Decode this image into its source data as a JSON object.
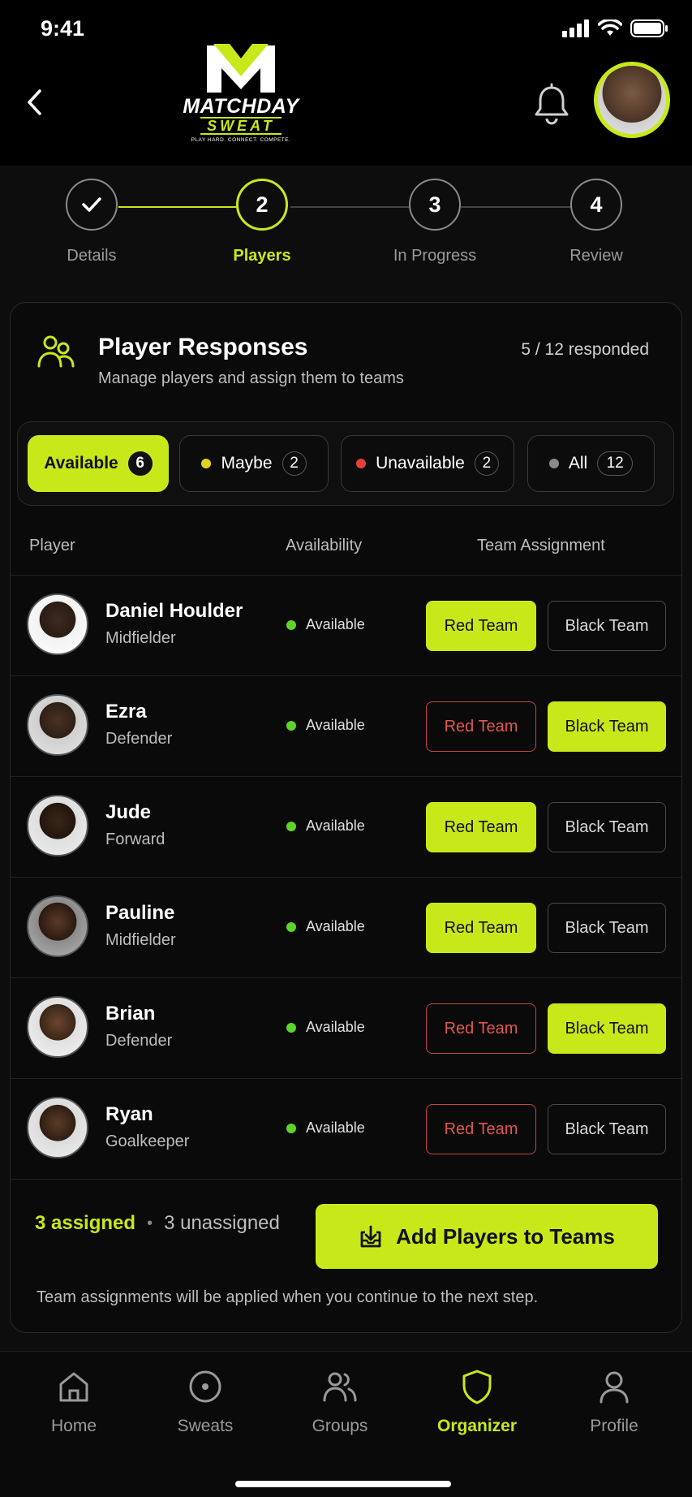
{
  "status_bar": {
    "time": "9:41"
  },
  "header": {
    "logo_line1": "MATCHDAY",
    "logo_line2": "SWEAT",
    "logo_tagline": "PLAY HARD. CONNECT. COMPETE."
  },
  "stepper": {
    "steps": [
      {
        "label": "Details",
        "number": "",
        "state": "done"
      },
      {
        "label": "Players",
        "number": "2",
        "state": "active"
      },
      {
        "label": "In Progress",
        "number": "3",
        "state": "todo"
      },
      {
        "label": "Review",
        "number": "4",
        "state": "todo"
      }
    ]
  },
  "panel": {
    "title": "Player Responses",
    "subtitle": "Manage players and assign them to teams",
    "responded": "5 / 12 responded"
  },
  "filters": [
    {
      "label": "Available",
      "count": "6",
      "active": true
    },
    {
      "label": "Maybe",
      "count": "2",
      "dot_color": "#e0d21a"
    },
    {
      "label": "Unavailable",
      "count": "2",
      "dot_color": "#e5403a"
    },
    {
      "label": "All",
      "count": "12",
      "dot_color": "#8a8a8a"
    }
  ],
  "table": {
    "headers": {
      "player": "Player",
      "availability": "Availability",
      "team": "Team Assignment"
    },
    "rows": [
      {
        "name": "Daniel Houlder",
        "position": "Midfielder",
        "availability": "Available",
        "red_label": "Red Team",
        "black_label": "Black Team",
        "assigned": "red"
      },
      {
        "name": "Ezra",
        "position": "Defender",
        "availability": "Available",
        "red_label": "Red Team",
        "black_label": "Black Team",
        "assigned": "black"
      },
      {
        "name": "Jude",
        "position": "Forward",
        "availability": "Available",
        "red_label": "Red Team",
        "black_label": "Black Team",
        "assigned": "red"
      },
      {
        "name": "Pauline",
        "position": "Midfielder",
        "availability": "Available",
        "red_label": "Red Team",
        "black_label": "Black Team",
        "assigned": "red"
      },
      {
        "name": "Brian",
        "position": "Defender",
        "availability": "Available",
        "red_label": "Red Team",
        "black_label": "Black Team",
        "assigned": "black"
      },
      {
        "name": "Ryan",
        "position": "Goalkeeper",
        "availability": "Available",
        "red_label": "Red Team",
        "black_label": "Black Team",
        "assigned": "none"
      }
    ]
  },
  "summary": {
    "assigned": "3 assigned",
    "separator": "•",
    "unassigned": "3 unassigned",
    "add_button": "Add Players to Teams",
    "footnote": "Team assignments will be applied when you continue to the next step."
  },
  "nav": [
    {
      "label": "Home",
      "icon": "home-icon"
    },
    {
      "label": "Sweats",
      "icon": "target-icon"
    },
    {
      "label": "Groups",
      "icon": "groups-icon"
    },
    {
      "label": "Organizer",
      "icon": "shield-icon",
      "active": true
    },
    {
      "label": "Profile",
      "icon": "user-icon"
    }
  ],
  "colors": {
    "accent": "#c8e81a",
    "red": "#e0574f",
    "available": "#5fd32c",
    "background": "#000000"
  }
}
